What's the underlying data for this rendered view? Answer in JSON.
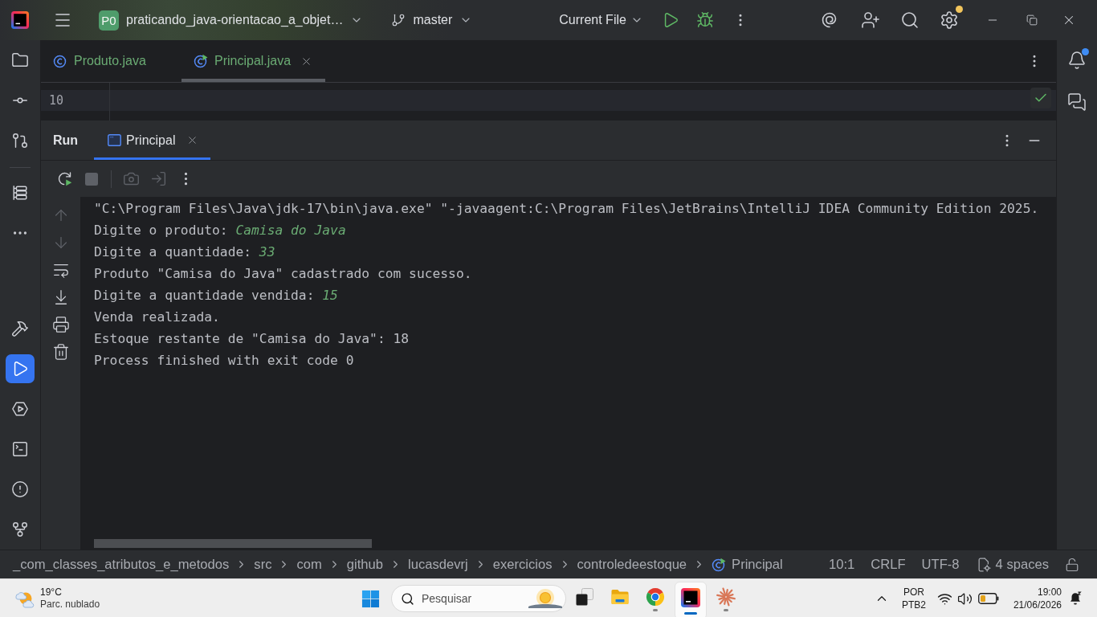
{
  "title_bar": {
    "project_badge": "P0",
    "project_name": "praticando_java-orientacao_a_objet…",
    "branch": "master",
    "run_configuration": "Current File",
    "settings_badge": true
  },
  "left_toolbar": {
    "top_groups": [
      [
        {
          "kind": "project",
          "selected": false
        },
        {
          "kind": "commit",
          "selected": false
        },
        {
          "kind": "pull_requests",
          "selected": false
        }
      ],
      [
        {
          "kind": "structure",
          "selected": false
        },
        {
          "kind": "more",
          "selected": false
        }
      ]
    ],
    "bottom": [
      {
        "kind": "build",
        "selected": false
      },
      {
        "kind": "run",
        "selected": true
      },
      {
        "kind": "services",
        "selected": false
      },
      {
        "kind": "terminal",
        "selected": false
      },
      {
        "kind": "problems",
        "selected": false
      },
      {
        "kind": "git",
        "selected": false
      }
    ]
  },
  "editor_tabs": [
    {
      "label": "Produto.java",
      "kind": "class",
      "selected": false
    },
    {
      "label": "Principal.java",
      "kind": "runnable_class",
      "selected": true
    }
  ],
  "right_toolbar": [
    {
      "kind": "notifications",
      "unread": true
    },
    {
      "kind": "ai_chat",
      "unread": false
    }
  ],
  "editor": {
    "line_number": "10"
  },
  "run_panel": {
    "title": "Run",
    "tabs": [
      {
        "label": "Principal",
        "selected": true
      }
    ],
    "toolbar_groups": [
      [
        {
          "kind": "rerun",
          "disabled": false
        },
        {
          "kind": "stop",
          "disabled": true
        }
      ],
      [
        {
          "kind": "screenshot",
          "disabled": true
        },
        {
          "kind": "attach",
          "disabled": true
        },
        {
          "kind": "more",
          "disabled": false
        }
      ]
    ],
    "gutter": [
      {
        "kind": "up",
        "disabled": true
      },
      {
        "kind": "down",
        "disabled": true
      },
      {
        "kind": "soft_wrap",
        "disabled": false
      },
      {
        "kind": "scroll_to_end",
        "disabled": false
      },
      {
        "kind": "print",
        "disabled": false
      },
      {
        "kind": "clear",
        "disabled": false
      }
    ],
    "console_lines": [
      {
        "text": "\"C:\\Program Files\\Java\\jdk-17\\bin\\java.exe\" \"-javaagent:C:\\Program Files\\JetBrains\\IntelliJ IDEA Community Edition 2025."
      },
      {
        "text": "Digite o produto:",
        "input": "Camisa do Java"
      },
      {
        "text": "Digite a quantidade:",
        "input": "33"
      },
      {
        "text": "Produto \"Camisa do Java\" cadastrado com sucesso."
      },
      {
        "text": "Digite a quantidade vendida:",
        "input": "15"
      },
      {
        "text": "Venda realizada."
      },
      {
        "text": "Estoque restante de \"Camisa do Java\": 18"
      },
      {
        "text": "Process finished with exit code 0"
      }
    ]
  },
  "status_bar": {
    "breadcrumbs": [
      {
        "label": "_com_classes_atributos_e_metodos",
        "kind": "folder"
      },
      {
        "label": "src",
        "kind": "folder"
      },
      {
        "label": "com",
        "kind": "folder"
      },
      {
        "label": "github",
        "kind": "folder"
      },
      {
        "label": "lucasdevrj",
        "kind": "folder"
      },
      {
        "label": "exercicios",
        "kind": "folder"
      },
      {
        "label": "controledeestoque",
        "kind": "folder"
      },
      {
        "label": "Principal",
        "kind": "runnable_class"
      }
    ],
    "cursor_position": "10:1",
    "line_separator": "CRLF",
    "encoding": "UTF-8",
    "indentation": "4 spaces"
  },
  "taskbar": {
    "weather": {
      "temperature": "19°C",
      "condition": "Parc. nublado"
    },
    "search": {
      "placeholder": "Pesquisar"
    },
    "apps": [
      {
        "kind": "stacked_squares",
        "running": false,
        "selected": false
      },
      {
        "kind": "folder",
        "running": false,
        "selected": false
      },
      {
        "kind": "browser",
        "running": true,
        "selected": false
      },
      {
        "kind": "ide",
        "running": true,
        "selected": true
      },
      {
        "kind": "asterisk",
        "running": true,
        "selected": false
      }
    ],
    "language": "POR",
    "keyboard_layout": "PTB2",
    "time": "19:00",
    "date": "21/06/2026"
  }
}
